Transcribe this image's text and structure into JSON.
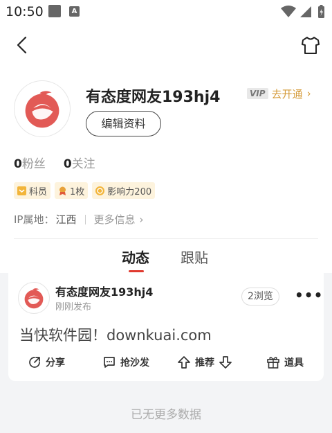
{
  "status_bar": {
    "time": "10:50",
    "notif_letter": "A"
  },
  "profile": {
    "username": "有态度网友193hj4",
    "vip_tag": "VIP",
    "vip_link": "去开通",
    "vip_arrow": "›",
    "edit_button": "编辑资料",
    "followers_count": "0",
    "followers_label": "粉丝",
    "following_count": "0",
    "following_label": "关注",
    "badges": [
      {
        "label": "科员",
        "icon": "rank-badge-icon"
      },
      {
        "label": "1枚",
        "icon": "medal-icon"
      },
      {
        "label": "影响力200",
        "icon": "influence-icon"
      }
    ],
    "ip_label": "IP属地：",
    "ip_value": "江西",
    "more_info": "更多信息",
    "more_chevron": "›"
  },
  "tabs": [
    {
      "label": "动态",
      "active": true
    },
    {
      "label": "跟贴",
      "active": false
    }
  ],
  "post": {
    "user": "有态度网友193hj4",
    "time": "刚刚发布",
    "views": "2浏览",
    "more": "•••",
    "content": "当快软件园！downkuai.com",
    "actions": {
      "share": "分享",
      "comment": "抢沙发",
      "recommend": "推荐",
      "tools": "道具"
    }
  },
  "footer_text": "已无更多数据",
  "colors": {
    "accent": "#e03a2f",
    "vip_gold": "#d59b3a",
    "badge_bg": "#fdf3dd",
    "feed_bg": "#f3f4f6"
  }
}
